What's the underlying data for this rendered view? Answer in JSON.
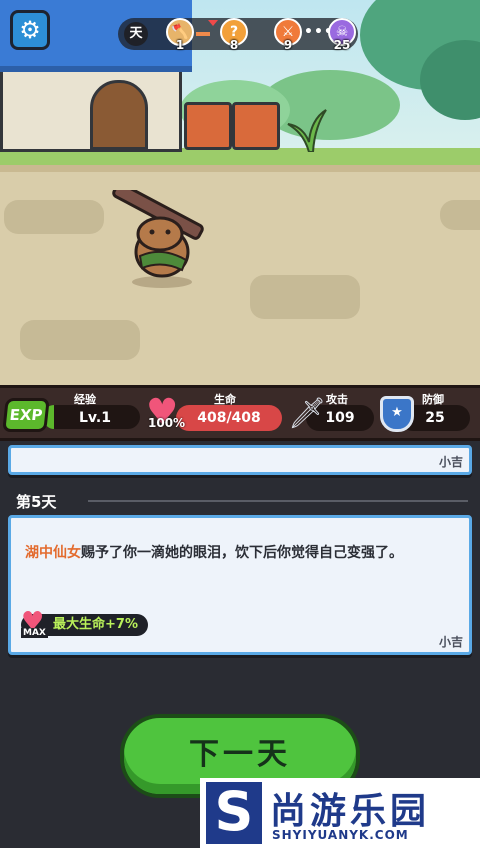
{
  "hud": {
    "settings_icon": "gear-icon",
    "day_label": "天",
    "stages": [
      {
        "icon": "axe-icon",
        "number": "1",
        "color": "#e7b46a"
      },
      {
        "icon": "question-icon",
        "number": "8",
        "color": "#f2a03a"
      },
      {
        "icon": "crossed-swords-icon",
        "number": "9",
        "color": "#f07a3a"
      },
      {
        "icon": "skull-icon",
        "number": "25",
        "color": "#9a6ae0"
      }
    ],
    "dots": "•••"
  },
  "stats": {
    "exp": {
      "badge": "EXP",
      "label": "经验",
      "value": "Lv.1"
    },
    "hp": {
      "label": "生命",
      "value": "408/408",
      "percent": "100%"
    },
    "attack": {
      "label": "攻击",
      "value": "109"
    },
    "defense": {
      "label": "防御",
      "value": "25"
    }
  },
  "log": {
    "prev_card_sign": "小吉",
    "day_heading": "第5天",
    "event": {
      "name": "湖中仙女",
      "text": "赐予了你一滴她的眼泪，饮下后你觉得自己变强了。",
      "reward_label": "MAX",
      "reward_text": "最大生命+7%",
      "sign": "小吉"
    }
  },
  "actions": {
    "next_day": "下一天"
  },
  "watermark": {
    "logo": "S",
    "title": "尚游乐园",
    "url": "SHYIYUANYK.COM"
  }
}
